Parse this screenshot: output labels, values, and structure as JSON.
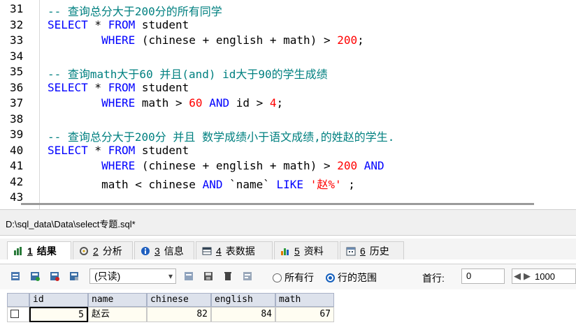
{
  "editor": {
    "line_numbers": [
      "31",
      "32",
      "33",
      "34",
      "35",
      "36",
      "37",
      "38",
      "39",
      "40",
      "41",
      "42",
      "43"
    ],
    "lines": [
      [
        {
          "t": "-- 查询总分大于200分的所有同学",
          "c": "cm"
        }
      ],
      [
        {
          "t": "SELECT",
          "c": "kw"
        },
        {
          "t": " * ",
          "c": ""
        },
        {
          "t": "FROM",
          "c": "kw"
        },
        {
          "t": " student",
          "c": ""
        }
      ],
      [
        {
          "t": "        ",
          "c": ""
        },
        {
          "t": "WHERE",
          "c": "kw"
        },
        {
          "t": " (chinese + english + math) > ",
          "c": ""
        },
        {
          "t": "200",
          "c": "num"
        },
        {
          "t": ";",
          "c": ""
        }
      ],
      [],
      [
        {
          "t": "-- 查询math大于60 并且(and) id大于90的学生成绩",
          "c": "cm"
        }
      ],
      [
        {
          "t": "SELECT",
          "c": "kw"
        },
        {
          "t": " * ",
          "c": ""
        },
        {
          "t": "FROM",
          "c": "kw"
        },
        {
          "t": " student",
          "c": ""
        }
      ],
      [
        {
          "t": "        ",
          "c": ""
        },
        {
          "t": "WHERE",
          "c": "kw"
        },
        {
          "t": " math > ",
          "c": ""
        },
        {
          "t": "60",
          "c": "num"
        },
        {
          "t": " ",
          "c": ""
        },
        {
          "t": "AND",
          "c": "kw"
        },
        {
          "t": " id > ",
          "c": ""
        },
        {
          "t": "4",
          "c": "num"
        },
        {
          "t": ";",
          "c": ""
        }
      ],
      [],
      [
        {
          "t": "-- 查询总分大于200分 并且 数学成绩小于语文成绩,的姓赵的学生.",
          "c": "cm"
        }
      ],
      [
        {
          "t": "SELECT",
          "c": "kw"
        },
        {
          "t": " * ",
          "c": ""
        },
        {
          "t": "FROM",
          "c": "kw"
        },
        {
          "t": " student",
          "c": ""
        }
      ],
      [
        {
          "t": "        ",
          "c": ""
        },
        {
          "t": "WHERE",
          "c": "kw"
        },
        {
          "t": " (chinese + english + math) > ",
          "c": ""
        },
        {
          "t": "200",
          "c": "num"
        },
        {
          "t": " ",
          "c": ""
        },
        {
          "t": "AND",
          "c": "kw"
        }
      ],
      [
        {
          "t": "        math < chinese ",
          "c": ""
        },
        {
          "t": "AND",
          "c": "kw"
        },
        {
          "t": " `name` ",
          "c": ""
        },
        {
          "t": "LIKE",
          "c": "kw"
        },
        {
          "t": " ",
          "c": ""
        },
        {
          "t": "'赵%'",
          "c": "str"
        },
        {
          "t": " ;",
          "c": ""
        }
      ],
      []
    ]
  },
  "path": "D:\\sql_data\\Data\\select专题.sql*",
  "tabs": [
    {
      "num": "1",
      "label": "结果",
      "active": true
    },
    {
      "num": "2",
      "label": "分析",
      "active": false
    },
    {
      "num": "3",
      "label": "信息",
      "active": false
    },
    {
      "num": "4",
      "label": "表数据",
      "active": false
    },
    {
      "num": "5",
      "label": "资料",
      "active": false
    },
    {
      "num": "6",
      "label": "历史",
      "active": false
    }
  ],
  "toolbar": {
    "mode_select": "(只读)",
    "radio_all": "所有行",
    "radio_range": "行的范围",
    "first_row_label": "首行:",
    "first_row_value": "0",
    "limit_value": "1000"
  },
  "grid": {
    "columns": [
      "id",
      "name",
      "chinese",
      "english",
      "math"
    ],
    "rows": [
      [
        "5",
        "赵云",
        "82",
        "84",
        "67"
      ]
    ]
  }
}
